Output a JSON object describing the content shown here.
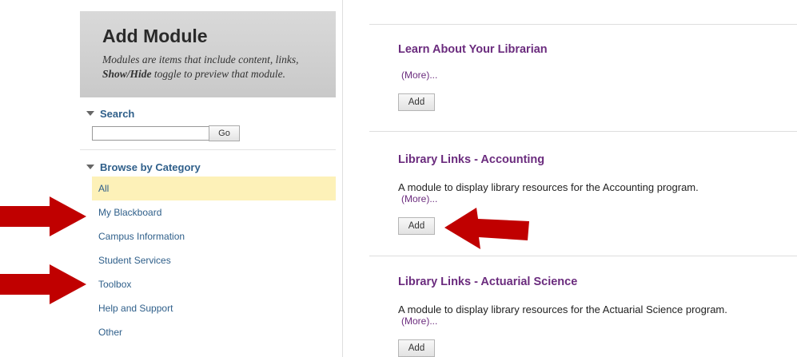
{
  "add_module": {
    "title": "Add Module",
    "desc_line1": "Modules are items that include content, links,",
    "desc_bold": "Show/Hide",
    "desc_line2": " toggle to preview that module."
  },
  "search": {
    "label": "Search",
    "input_value": "",
    "go_label": "Go"
  },
  "browse": {
    "label": "Browse by Category",
    "categories": [
      {
        "label": "All"
      },
      {
        "label": "My Blackboard"
      },
      {
        "label": "Campus Information"
      },
      {
        "label": "Student Services"
      },
      {
        "label": "Toolbox"
      },
      {
        "label": "Help and Support"
      },
      {
        "label": "Other"
      }
    ],
    "selected": "All"
  },
  "modules": [
    {
      "title": "Learn About Your Librarian",
      "description": "",
      "more": "(More)...",
      "add_label": "Add"
    },
    {
      "title": "Library Links - Accounting",
      "description": "A module to display library resources for the Accounting program.",
      "more": "(More)...",
      "add_label": "Add"
    },
    {
      "title": "Library Links - Actuarial Science",
      "description": "A module to display library resources for the Actuarial Science program.",
      "more": "(More)...",
      "add_label": "Add"
    }
  ],
  "colors": {
    "arrow": "#c00000",
    "link": "#2f5f8a",
    "module_title": "#6b2c7e",
    "selected_bg": "#fdf1b8"
  }
}
